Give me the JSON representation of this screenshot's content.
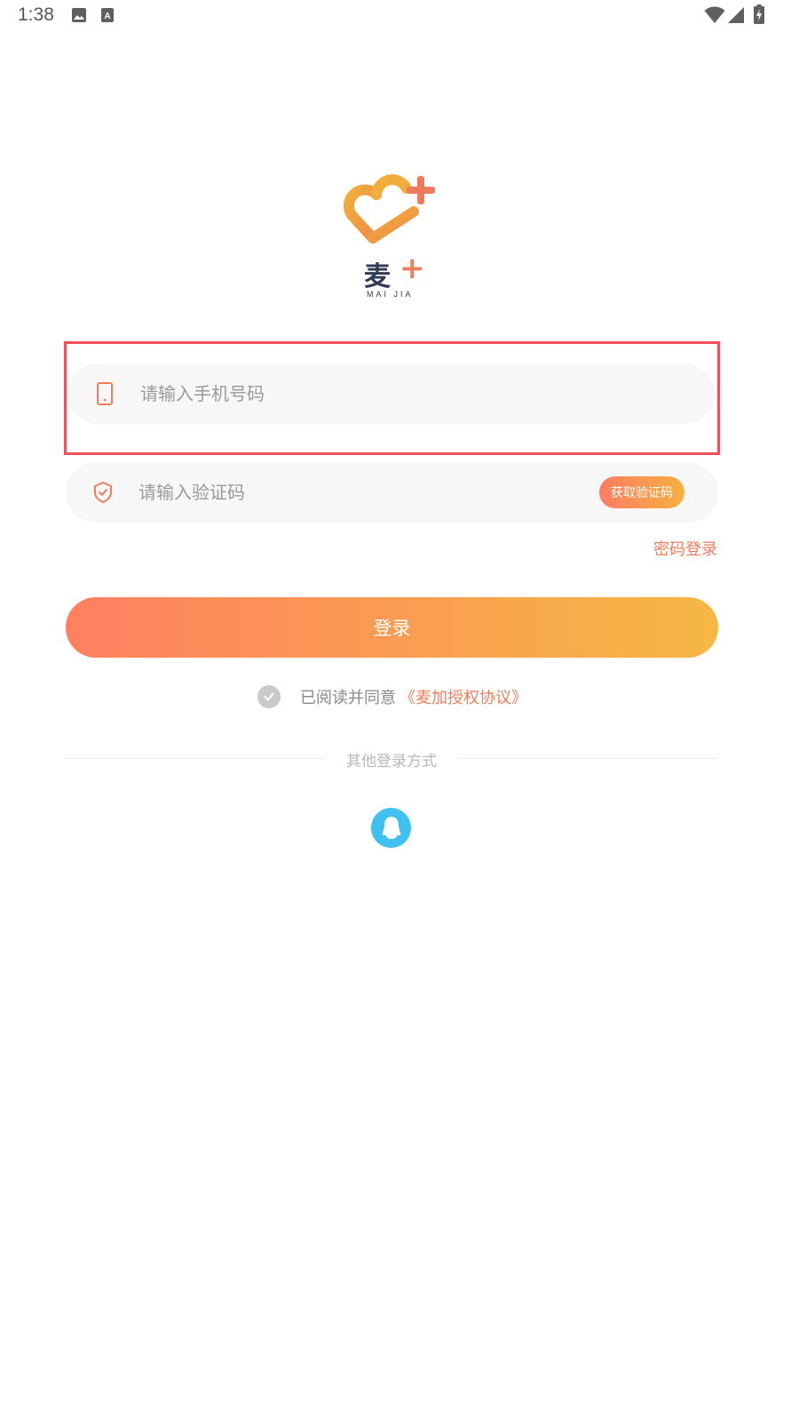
{
  "status_bar": {
    "time": "1:38",
    "left_icons": [
      "image-icon",
      "text-notification-icon"
    ],
    "right_icons": [
      "wifi-icon",
      "cell-signal-icon",
      "battery-charging-icon"
    ]
  },
  "logo": {
    "brand": "麦",
    "plus": "+",
    "sub": "MAI JIA"
  },
  "phone_field": {
    "placeholder": "请输入手机号码",
    "icon": "phone-icon"
  },
  "code_field": {
    "placeholder": "请输入验证码",
    "icon": "shield-check-icon",
    "get_code_label": "获取验证码"
  },
  "password_login_link": "密码登录",
  "login_button": "登录",
  "agreement": {
    "prefix": "已阅读并同意",
    "link": "《麦加授权协议》"
  },
  "other_login": {
    "label": "其他登录方式",
    "icons": [
      "qq-icon"
    ]
  },
  "colors": {
    "accent": "#f07e5a",
    "gradient_start": "#ff8061",
    "gradient_end": "#f6b843",
    "highlight_border": "#f0505a",
    "qq_blue": "#3ec1f1"
  }
}
